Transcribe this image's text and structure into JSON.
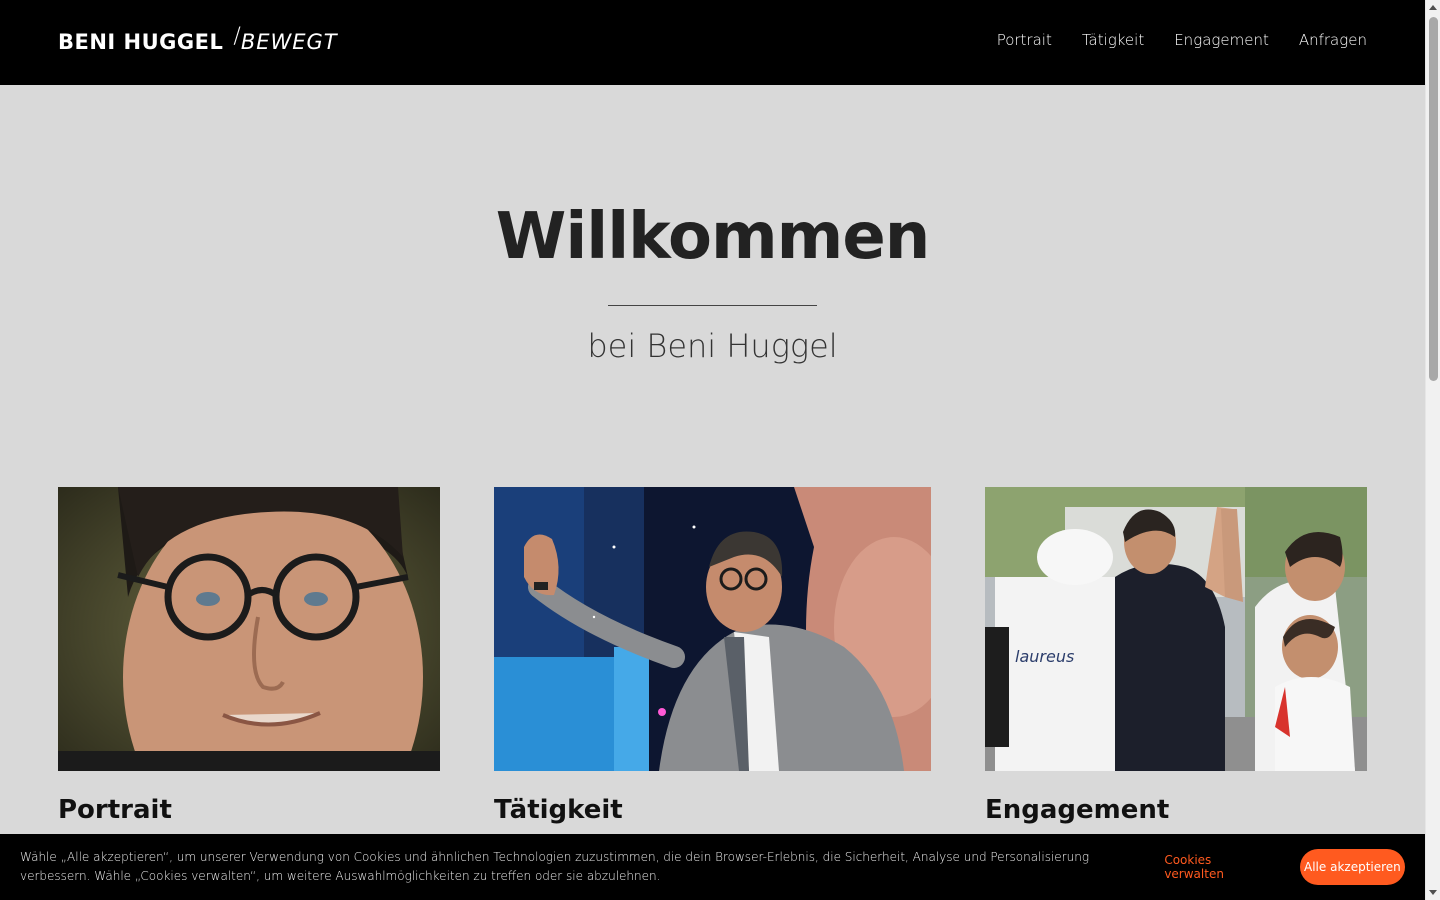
{
  "header": {
    "logo_main": "BENI HUGGEL",
    "logo_slash": "/",
    "logo_sub": "BEWEGT",
    "nav": [
      {
        "label": "Portrait"
      },
      {
        "label": "Tätigkeit"
      },
      {
        "label": "Engagement"
      },
      {
        "label": "Anfragen"
      }
    ]
  },
  "hero": {
    "title": "Willkommen",
    "subtitle": "bei Beni Huggel"
  },
  "cards": [
    {
      "title": "Portrait"
    },
    {
      "title": "Tätigkeit"
    },
    {
      "title": "Engagement"
    }
  ],
  "cookie_banner": {
    "text": "Wähle „Alle akzeptieren“, um unserer Verwendung von Cookies und ähnlichen Technologien zuzustimmen, die dein Browser-Erlebnis, die Sicherheit, Analyse und Personalisierung verbessern. Wähle „Cookies verwalten“, um weitere Auswahlmöglichkeiten zu treffen oder sie abzulehnen.",
    "manage_label": "Cookies verwalten",
    "accept_label": "Alle akzeptieren"
  },
  "colors": {
    "header_bg": "#000000",
    "page_bg": "#d9d9d9",
    "accent": "#ff5a1f"
  }
}
